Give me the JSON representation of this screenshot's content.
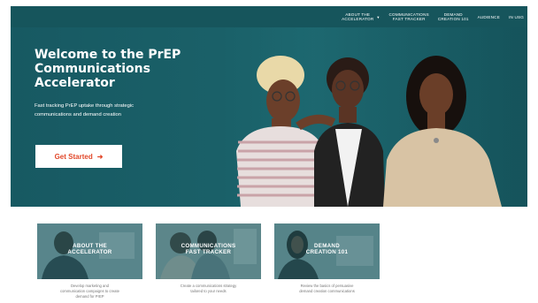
{
  "nav": {
    "items": [
      {
        "line1": "About the",
        "line2": "Accelerator",
        "has_caret": true
      },
      {
        "line1": "Communications",
        "line2": "Fast Tracker",
        "has_caret": false
      },
      {
        "line1": "Demand",
        "line2": "Creation 101",
        "has_caret": false
      },
      {
        "line1": "Audience",
        "line2": "",
        "has_caret": false
      },
      {
        "line1": "In USG",
        "line2": "",
        "has_caret": false
      }
    ],
    "caret_icon": "chevron-down-icon"
  },
  "hero": {
    "title_lines": [
      "Welcome to the PrEP",
      "Communications",
      "Accelerator"
    ],
    "subtitle_lines": [
      "Fast tracking PrEP uptake through strategic",
      "communications and demand creation"
    ],
    "cta_label": "Get Started",
    "cta_icon": "arrow-right-icon",
    "bg_color": "#16555c",
    "cta_color": "#e2492b"
  },
  "cards": [
    {
      "title_lines": [
        "About the",
        "Accelerator"
      ],
      "desc_lines": [
        "Develop marketing and",
        "communication campaigns to create",
        "demand for PrEP"
      ]
    },
    {
      "title_lines": [
        "Communications",
        "Fast Tracker"
      ],
      "desc_lines": [
        "Create a communications strategy",
        "tailored to your needs"
      ]
    },
    {
      "title_lines": [
        "Demand",
        "Creation 101"
      ],
      "desc_lines": [
        "Review the basics of persuasive",
        "demand creation communications"
      ]
    }
  ]
}
